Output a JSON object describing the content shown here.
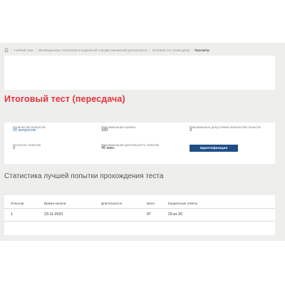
{
  "breadcrumb": {
    "items": [
      "Учебный план",
      "Инновационные технологии в социальной и профессиональной деятельности",
      "Итоговый тест (пересдача)",
      "Просмотр"
    ],
    "separator": "/"
  },
  "test": {
    "title": "Итоговый тест (пересдача)"
  },
  "info": {
    "questions_label": "Количество вопросов",
    "questions_value": "30 вопросов",
    "max_score_label": "Максимальная оценка",
    "max_score_value": "100",
    "max_attempts_label": "Максимально допустимое количество попыток",
    "max_attempts_value": "3",
    "remaining_label": "Осталось попыток",
    "remaining_value": "2",
    "max_duration_label": "Максимальная длительность попытки",
    "max_duration_value": "45 мин.",
    "identify_button": "Идентификация"
  },
  "stats": {
    "title": "Статистика лучшей попытки прохождения теста",
    "headers": [
      "Попытки",
      "Время начала",
      "Длительность",
      "Балл",
      "Корректные ответы"
    ],
    "row": [
      "1",
      "23-11-2023",
      "",
      "97",
      "29 из 30"
    ]
  },
  "colors": {
    "title": "#e2343f",
    "button": "#1f4e86",
    "background": "#eeeeec"
  }
}
